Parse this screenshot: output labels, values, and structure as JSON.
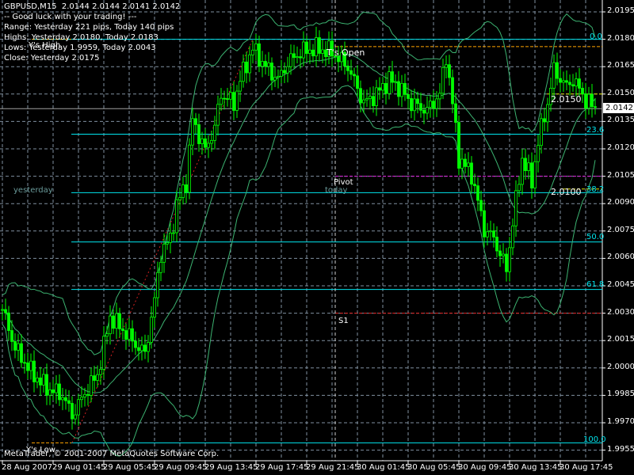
{
  "header": {
    "symbol_line": "GBPUSD,M15  2.0144 2.0144 2.0141 2.0142",
    "lines": [
      "-- Good luck with your trading! ---",
      "Range: Yesterday 221 pips, Today 140 pips",
      "Highs: Yesterday 2.0180, Today 2.0183",
      "Lows: Yesterday 1.9959, Today 2.0043",
      "Close: Yesterday 2.0175"
    ]
  },
  "footer": "MetaTrader, © 2001-2007 MetaQuotes Software Corp.",
  "current_price": "2.0142",
  "chart_data": {
    "type": "candlestick",
    "symbol": "GBPUSD",
    "timeframe": "M15",
    "ylim": [
      1.995,
      2.02
    ],
    "y_ticks": [
      "2.0195",
      "2.0180",
      "2.0165",
      "2.0150",
      "2.0135",
      "2.0120",
      "2.0105",
      "2.0090",
      "2.0075",
      "2.0060",
      "2.0045",
      "2.0030",
      "2.0015",
      "2.0000",
      "1.9985",
      "1.9970",
      "1.9955"
    ],
    "x_ticks": [
      "28 Aug 2007",
      "29 Aug 01:45",
      "29 Aug 05:45",
      "29 Aug 09:45",
      "29 Aug 13:45",
      "29 Aug 17:45",
      "29 Aug 21:45",
      "30 Aug 01:45",
      "30 Aug 05:45",
      "30 Aug 09:45",
      "30 Aug 13:45",
      "30 Aug 17:45"
    ],
    "grid": true,
    "close_path": [
      [
        0,
        2.0032
      ],
      [
        4,
        2.0011
      ],
      [
        9,
        1.9998
      ],
      [
        14,
        1.9989
      ],
      [
        19,
        1.9985
      ],
      [
        22,
        1.9974
      ],
      [
        27,
        1.9989
      ],
      [
        30,
        1.9996
      ],
      [
        34,
        2.0028
      ],
      [
        39,
        2.0019
      ],
      [
        43,
        2.0011
      ],
      [
        45,
        2.0008
      ],
      [
        48,
        2.0037
      ],
      [
        50,
        2.0063
      ],
      [
        53,
        2.0071
      ],
      [
        55,
        2.0089
      ],
      [
        58,
        2.0102
      ],
      [
        60,
        2.0136
      ],
      [
        64,
        2.0119
      ],
      [
        67,
        2.0132
      ],
      [
        69,
        2.015
      ],
      [
        73,
        2.0145
      ],
      [
        75,
        2.0158
      ],
      [
        79,
        2.0175
      ],
      [
        83,
        2.0165
      ],
      [
        87,
        2.0158
      ],
      [
        90,
        2.0167
      ],
      [
        94,
        2.0173
      ],
      [
        99,
        2.0175
      ],
      [
        104,
        2.0173
      ],
      [
        109,
        2.0165
      ],
      [
        114,
        2.0145
      ],
      [
        118,
        2.015
      ],
      [
        122,
        2.0158
      ],
      [
        125,
        2.0154
      ],
      [
        129,
        2.0145
      ],
      [
        134,
        2.0141
      ],
      [
        138,
        2.015
      ],
      [
        140,
        2.0171
      ],
      [
        142,
        2.0145
      ],
      [
        144,
        2.0115
      ],
      [
        148,
        2.0106
      ],
      [
        152,
        2.0076
      ],
      [
        155,
        2.0071
      ],
      [
        159,
        2.0054
      ],
      [
        161,
        2.008
      ],
      [
        164,
        2.0115
      ],
      [
        167,
        2.0102
      ],
      [
        169,
        2.0124
      ],
      [
        172,
        2.0145
      ],
      [
        174,
        2.0163
      ],
      [
        178,
        2.0154
      ],
      [
        180,
        2.0158
      ],
      [
        184,
        2.0147
      ],
      [
        187,
        2.0142
      ]
    ],
    "bollinger": {
      "period": 20,
      "deviations": 2
    },
    "fibonacci": [
      {
        "label": "0.0",
        "price": 2.018
      },
      {
        "label": "23.6",
        "price": 2.0128
      },
      {
        "label": "38.2",
        "price": 2.0096
      },
      {
        "label": "50.0",
        "price": 2.0069
      },
      {
        "label": "61.8",
        "price": 2.0043
      },
      {
        "label": "100.0",
        "price": 1.9959
      }
    ],
    "levels": {
      "pivot": {
        "label": "Pivot",
        "price": 2.0105
      },
      "s1": {
        "label": "S1",
        "price": 2.003
      },
      "ys_high": {
        "label": "Y's High",
        "price": 2.018
      },
      "ts_open": {
        "label": "T's Open",
        "price": 2.0176
      },
      "ys_low": {
        "label": "Y's Low",
        "price": 1.9959
      },
      "today_high_marker": {
        "label": "2.0150",
        "price": 2.015
      },
      "today_low_marker": {
        "label": "2.0100",
        "price": 2.0098
      }
    },
    "annotations": {
      "yesterday": "yesterday",
      "today": "today"
    },
    "colors": {
      "candle": "#00ff00",
      "bands": "#3cb371",
      "fib": "#00e5ee",
      "pivot": "#e020e0",
      "s1": "#e02020",
      "marker": "#ffa500",
      "yellow": "#e0e000",
      "grid": "#8090a0",
      "zigzag": "#d02020"
    }
  }
}
